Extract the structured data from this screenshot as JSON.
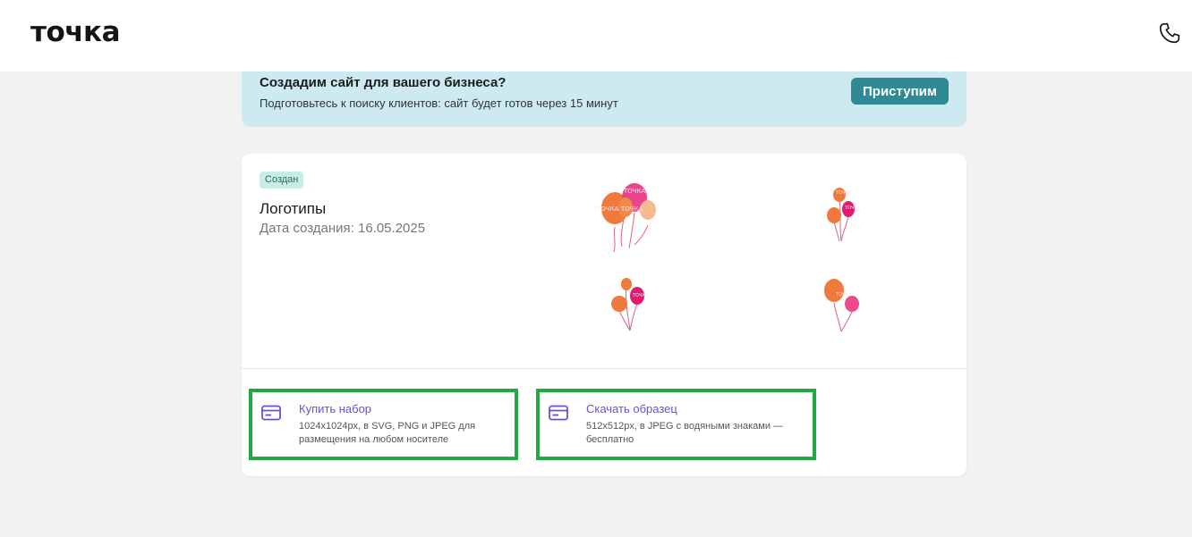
{
  "header": {
    "logo": "точка",
    "phone_icon": "phone-icon"
  },
  "banner": {
    "title": "Создадим сайт для вашего бизнеса?",
    "subtitle": "Подготовьтесь к поиску клиентов: сайт будет готов через 15 минут",
    "button_label": "Приступим"
  },
  "card": {
    "status": "Создан",
    "title": "Логотипы",
    "date": "Дата создания: 16.05.2025",
    "logo_text": "ТОЧКА"
  },
  "actions": [
    {
      "label": "Купить набор",
      "desc_line1": "1024x1024px, в SVG, PNG и JPEG для",
      "desc_line2": "размещения на любом носителе",
      "icon": "card-icon"
    },
    {
      "label": "Скачать образец",
      "desc_line1": "512x512px, в JPEG с водяными знаками —",
      "desc_line2": "бесплатно",
      "icon": "card-icon"
    }
  ],
  "colors": {
    "accent": "#2f8a93",
    "banner_bg": "#cdeaf0",
    "link": "#6b4fd6",
    "highlight": "#22a744",
    "badge_bg": "#c7ede4"
  }
}
